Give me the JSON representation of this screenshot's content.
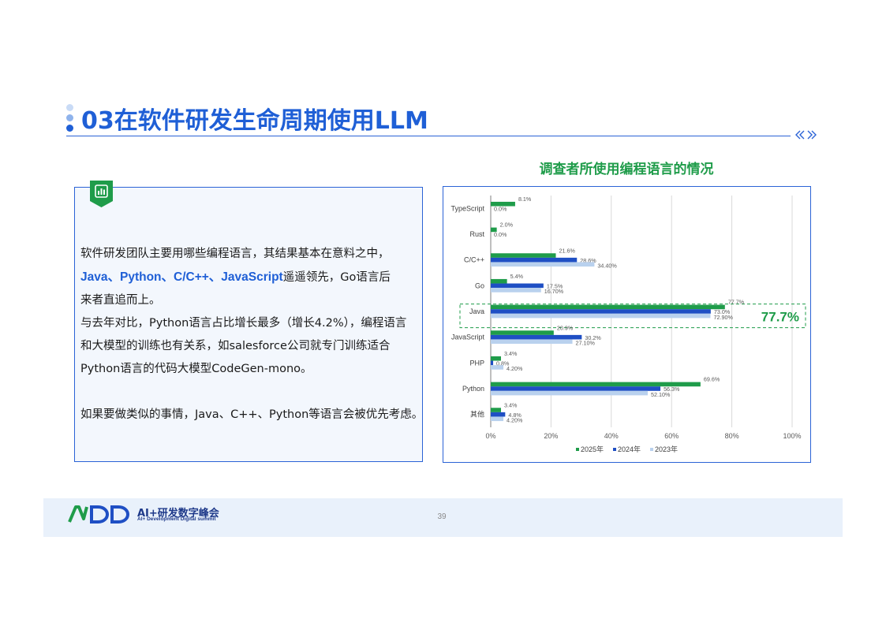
{
  "page": {
    "title": "03在软件研发生命周期使用LLM",
    "nav_icon": "double-chevron-icon",
    "page_number": "39"
  },
  "text_panel": {
    "badge_icon": "bar-chart-icon",
    "line1": "软件研发团队主要用哪些编程语言，其结果基本在意料之中，",
    "highlight": "Java、Python、C/C++、JavaScript",
    "line2_tail": "遥遥领先，Go语言后",
    "line3": "来者直追而上。",
    "line4": "与去年对比，Python语言占比增长最多（增长4.2%），编程语言",
    "line5": "和大模型的训练也有关系，如salesforce公司就专门训练适合",
    "line6": "Python语言的代码大模型CodeGen-mono。",
    "line7": "如果要做类似的事情，Java、C++、Python等语言会被优先考虑。"
  },
  "chart_data": {
    "type": "bar",
    "orientation": "horizontal",
    "title": "调查者所使用编程语言的情况",
    "categories": [
      "TypeScript",
      "Rust",
      "C/C++",
      "Go",
      "Java",
      "JavaScript",
      "PHP",
      "Python",
      "其他"
    ],
    "series": [
      {
        "name": "2025年",
        "color": "#1f9c4a",
        "values": [
          8.1,
          2.0,
          21.6,
          5.4,
          77.7,
          20.9,
          3.4,
          69.6,
          3.4
        ],
        "labels": [
          "8.1%",
          "2.0%",
          "21.6%",
          "5.4%",
          "77.7%",
          "20.9%",
          "3.4%",
          "69.6%",
          "3.4%"
        ]
      },
      {
        "name": "2024年",
        "color": "#1f4fc4",
        "values": [
          0.0,
          0.0,
          28.6,
          17.5,
          73.0,
          30.2,
          0.8,
          56.3,
          4.8
        ],
        "labels": [
          "0.0%",
          "0.0%",
          "28.6%",
          "17.5%",
          "73.0%",
          "30.2%",
          "0.8%",
          "56.3%",
          "4.8%"
        ]
      },
      {
        "name": "2023年",
        "color": "#b9d1ee",
        "values": [
          null,
          null,
          34.4,
          16.7,
          72.9,
          27.1,
          4.2,
          52.1,
          4.2
        ],
        "labels": [
          "",
          "",
          "34.40%",
          "16.70%",
          "72.90%",
          "27.10%",
          "4.20%",
          "52.10%",
          "4.20%"
        ]
      }
    ],
    "xlim": [
      0,
      100
    ],
    "xticks": [
      "0%",
      "20%",
      "40%",
      "60%",
      "80%",
      "100%"
    ],
    "grid": true,
    "legend": "bottom",
    "callout": {
      "category": "Java",
      "text": "77.7%",
      "color": "#1f9c4a"
    }
  },
  "footer": {
    "logo_text": "AiDD",
    "logo_cn": "AI+研发数字峰会",
    "logo_en": "AI+ Development Digital summit"
  }
}
